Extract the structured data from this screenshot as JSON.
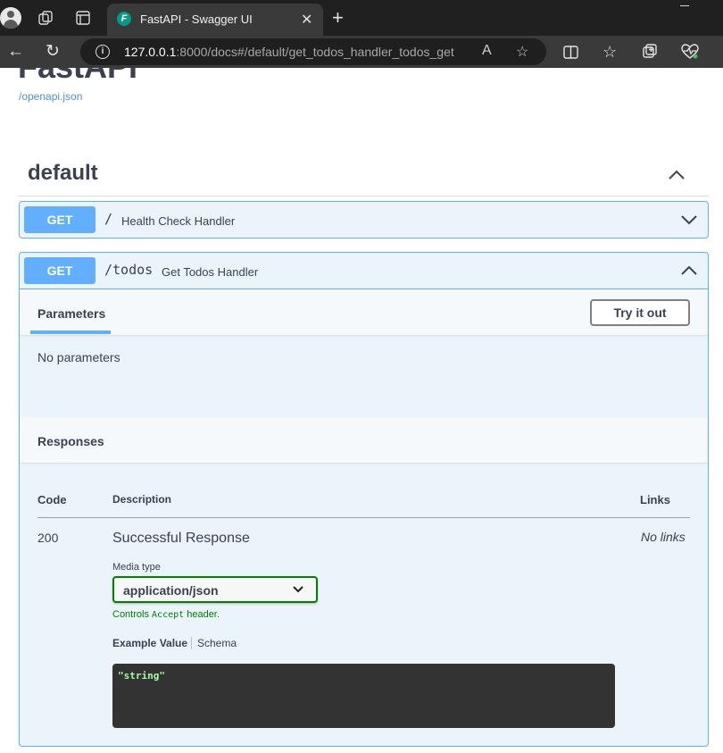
{
  "browser": {
    "tab_title": "FastAPI - Swagger UI",
    "favicon_letter": "F",
    "url_host": "127.0.0.1",
    "url_rest": ":8000/docs#/default/get_todos_handler_todos_get"
  },
  "page": {
    "title": "FastAPI",
    "openapi_link": "/openapi.json"
  },
  "section": {
    "name": "default"
  },
  "operations": [
    {
      "method": "GET",
      "path": "/",
      "summary": "Health Check Handler",
      "expanded": false
    },
    {
      "method": "GET",
      "path": "/todos",
      "summary": "Get Todos Handler",
      "expanded": true,
      "parameters_tab": "Parameters",
      "try_it_out": "Try it out",
      "no_parameters": "No parameters",
      "responses_title": "Responses",
      "columns": {
        "code": "Code",
        "description": "Description",
        "links": "Links"
      },
      "responses": [
        {
          "code": "200",
          "description": "Successful Response",
          "links": "No links",
          "media_type_label": "Media type",
          "media_type": "application/json",
          "controls_prefix": "Controls",
          "controls_code": "Accept",
          "controls_suffix": "header.",
          "example_tab": "Example Value",
          "schema_tab": "Schema",
          "example": "\"string\""
        }
      ]
    }
  ],
  "colors": {
    "get_method": "#61affe",
    "opblock_bg": "#ebf3fb",
    "media_border": "#008000",
    "code_bg": "#333333",
    "code_text": "#a2fca2"
  }
}
